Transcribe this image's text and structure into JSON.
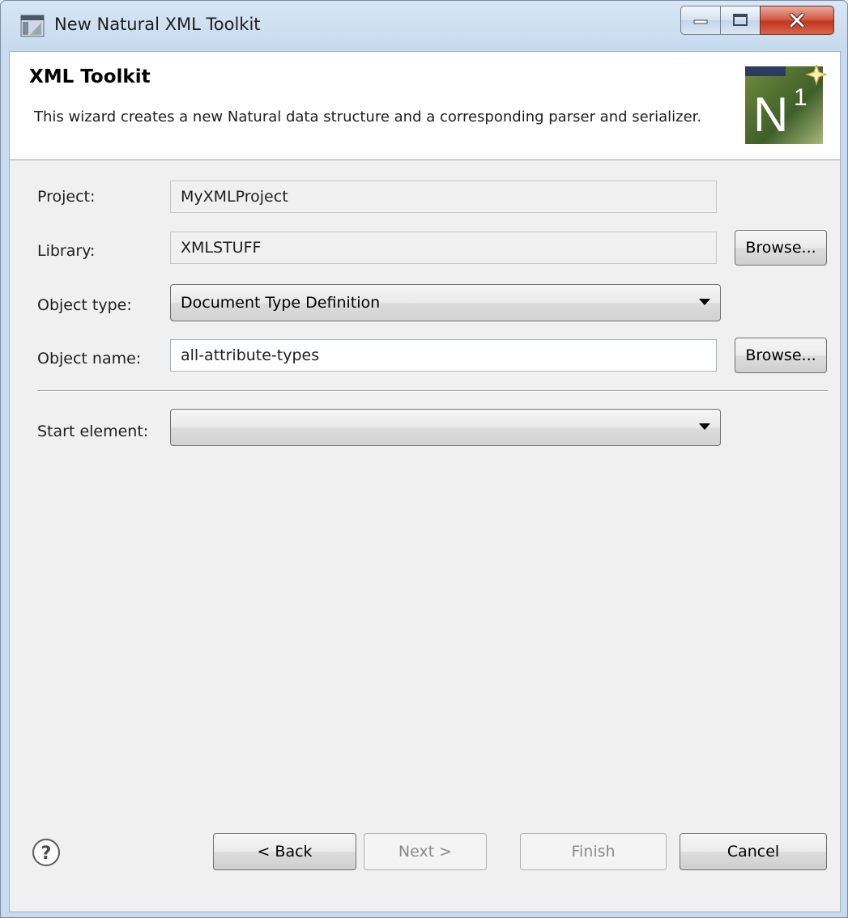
{
  "window": {
    "title": "New Natural XML Toolkit",
    "app_icon": "window-app-icon",
    "controls": [
      "minimize-icon",
      "maximize-icon",
      "close-icon"
    ]
  },
  "banner": {
    "title": "XML Toolkit",
    "description": "This wizard creates a new Natural data structure and a corresponding parser and serializer.",
    "logo_text": "N",
    "logo_superscript": "1",
    "logo_icon": "natural-n1-logo"
  },
  "form": {
    "project": {
      "label": "Project:",
      "value": "MyXMLProject"
    },
    "library": {
      "label": "Library:",
      "value": "XMLSTUFF",
      "browse_label": "Browse..."
    },
    "object_type": {
      "label": "Object type:",
      "value": "Document Type Definition"
    },
    "object_name": {
      "label": "Object name:",
      "value": "all-attribute-types",
      "browse_label": "Browse..."
    },
    "start_element": {
      "label": "Start element:",
      "value": ""
    }
  },
  "buttons": {
    "back": "< Back",
    "next": "Next >",
    "finish": "Finish",
    "cancel": "Cancel"
  },
  "help_icon": "question-mark-icon",
  "colors": {
    "banner_bg": "#ffffff",
    "dialog_bg": "#f0f0f0",
    "close_red": "#c2381f",
    "logo_green": "#4a6b2c"
  }
}
